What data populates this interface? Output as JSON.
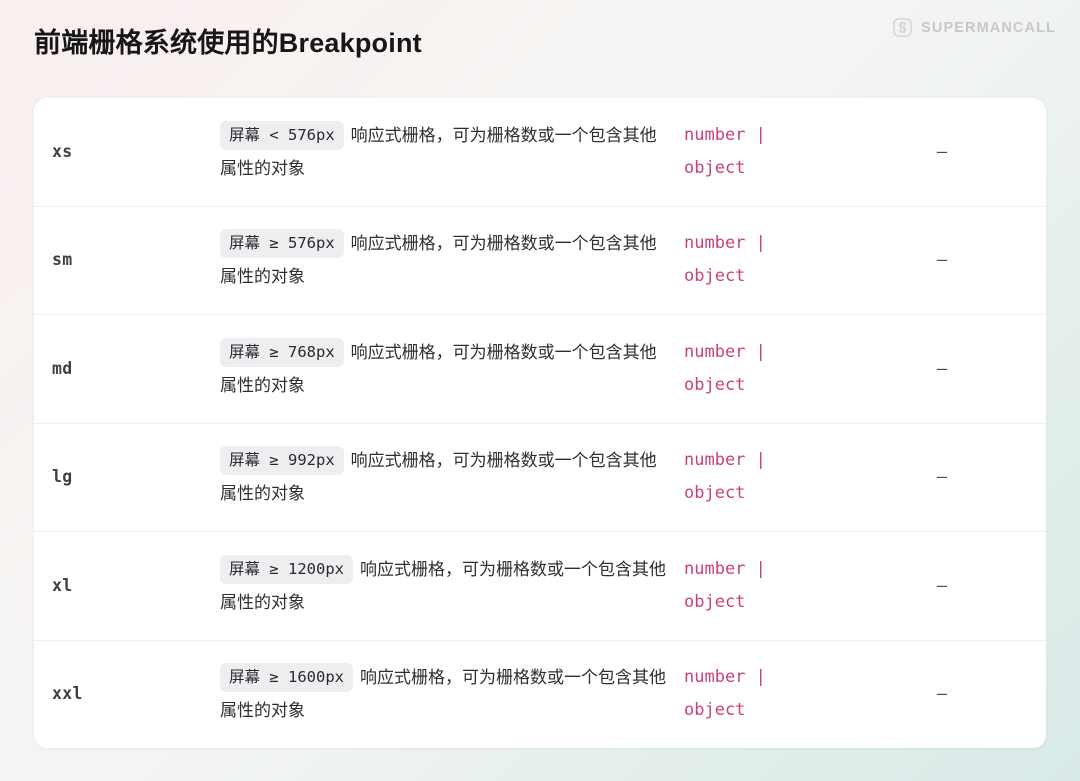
{
  "header": {
    "title": "前端栅格系统使用的Breakpoint",
    "brand_name": "SUPERMANCALL",
    "brand_icon": "s-monogram-icon"
  },
  "colors": {
    "type_pink": "#c9407a",
    "badge_bg": "#eceef0",
    "card_bg": "#ffffff",
    "bg_gradient_start": "#f9efee",
    "bg_gradient_end": "#d9e9e7",
    "divider": "#f0f0f1"
  },
  "table": {
    "rows": [
      {
        "key": "xs",
        "badge": "屏幕 < 576px",
        "desc": "响应式栅格，可为栅格数或一个包含其他属性的对象",
        "type": "number |\nobject",
        "default": "–"
      },
      {
        "key": "sm",
        "badge": "屏幕 ≥ 576px",
        "desc": "响应式栅格，可为栅格数或一个包含其他属性的对象",
        "type": "number |\nobject",
        "default": "–"
      },
      {
        "key": "md",
        "badge": "屏幕 ≥ 768px",
        "desc": "响应式栅格，可为栅格数或一个包含其他属性的对象",
        "type": "number |\nobject",
        "default": "–"
      },
      {
        "key": "lg",
        "badge": "屏幕 ≥ 992px",
        "desc": "响应式栅格，可为栅格数或一个包含其他属性的对象",
        "type": "number |\nobject",
        "default": "–"
      },
      {
        "key": "xl",
        "badge": "屏幕 ≥ 1200px",
        "desc": "响应式栅格，可为栅格数或一个包含其他属性的对象",
        "type": "number |\nobject",
        "default": "–"
      },
      {
        "key": "xxl",
        "badge": "屏幕 ≥ 1600px",
        "desc": "响应式栅格，可为栅格数或一个包含其他属性的对象",
        "type": "number |\nobject",
        "default": "–"
      }
    ]
  }
}
